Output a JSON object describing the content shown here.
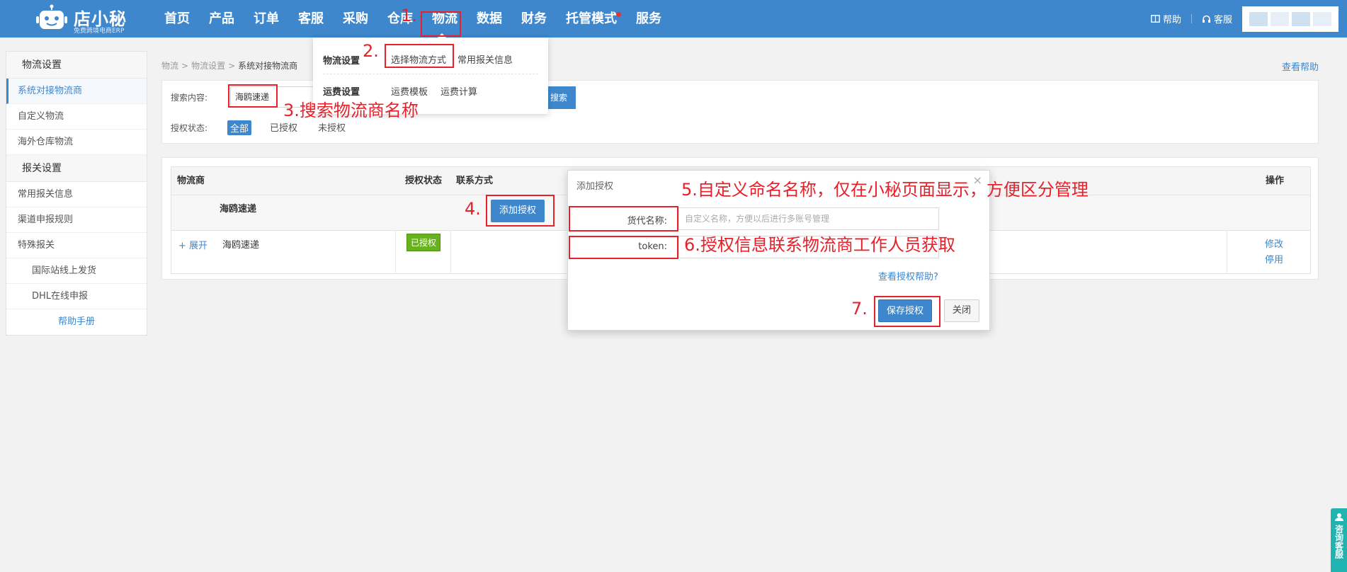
{
  "brand": {
    "name": "店小秘",
    "tagline": "免费跨境电商ERP"
  },
  "nav": {
    "items": [
      "首页",
      "产品",
      "订单",
      "客服",
      "采购",
      "仓库",
      "物流",
      "数据",
      "财务",
      "托管模式",
      "服务"
    ],
    "active": "物流"
  },
  "topright": {
    "help": "帮助",
    "service": "客服"
  },
  "dropdown": {
    "logistics_settings": "物流设置",
    "select_method": "选择物流方式",
    "customs_info": "常用报关信息",
    "freight_settings": "运费设置",
    "freight_template": "运费模板",
    "freight_calc": "运费计算"
  },
  "sidebar": {
    "sections": [
      {
        "title": "物流设置",
        "items": [
          "系统对接物流商",
          "自定义物流",
          "海外仓库物流"
        ]
      },
      {
        "title": "报关设置",
        "items": [
          "常用报关信息",
          "渠道申报规则",
          "特殊报关",
          "国际站线上发货",
          "DHL在线申报"
        ]
      }
    ],
    "help": "帮助手册"
  },
  "breadcrumb": {
    "level1": "物流",
    "level2": "物流设置",
    "current": "系统对接物流商",
    "sep": ">"
  },
  "help_link": "查看帮助",
  "search": {
    "label": "搜索内容:",
    "value": "海鸥速递",
    "button": "搜索",
    "status_label": "授权状态:",
    "filters": [
      "全部",
      "已授权",
      "未授权"
    ]
  },
  "table": {
    "headers": {
      "carrier": "物流商",
      "auth_status": "授权状态",
      "contact": "联系方式",
      "ops": "操作"
    },
    "group_name": "海鸥速递",
    "add_button": "添加授权",
    "row": {
      "expand": "+ 展开",
      "name": "海鸥速递",
      "status": "已授权",
      "edit": "修改",
      "disable": "停用"
    }
  },
  "modal": {
    "title": "添加授权",
    "close": "×",
    "name_label": "货代名称:",
    "name_placeholder": "自定义名称，方便以后进行多账号管理",
    "token_label": "token:",
    "token_value": "",
    "help": "查看授权帮助?",
    "save": "保存授权",
    "cancel": "关闭"
  },
  "annotations": {
    "s1": "1.",
    "s2": "2.",
    "s3": "3.搜索物流商名称",
    "s4": "4.",
    "s5": "5.自定义命名名称，仅在小秘页面显示，方便区分管理",
    "s6": "6.授权信息联系物流商工作人员获取",
    "s7": "7."
  },
  "consult": {
    "text": "咨询客服"
  },
  "colors": {
    "primary": "#3e87cc",
    "annotation": "#e8202a",
    "authorized": "#67b21d",
    "consult": "#20b3b0"
  }
}
